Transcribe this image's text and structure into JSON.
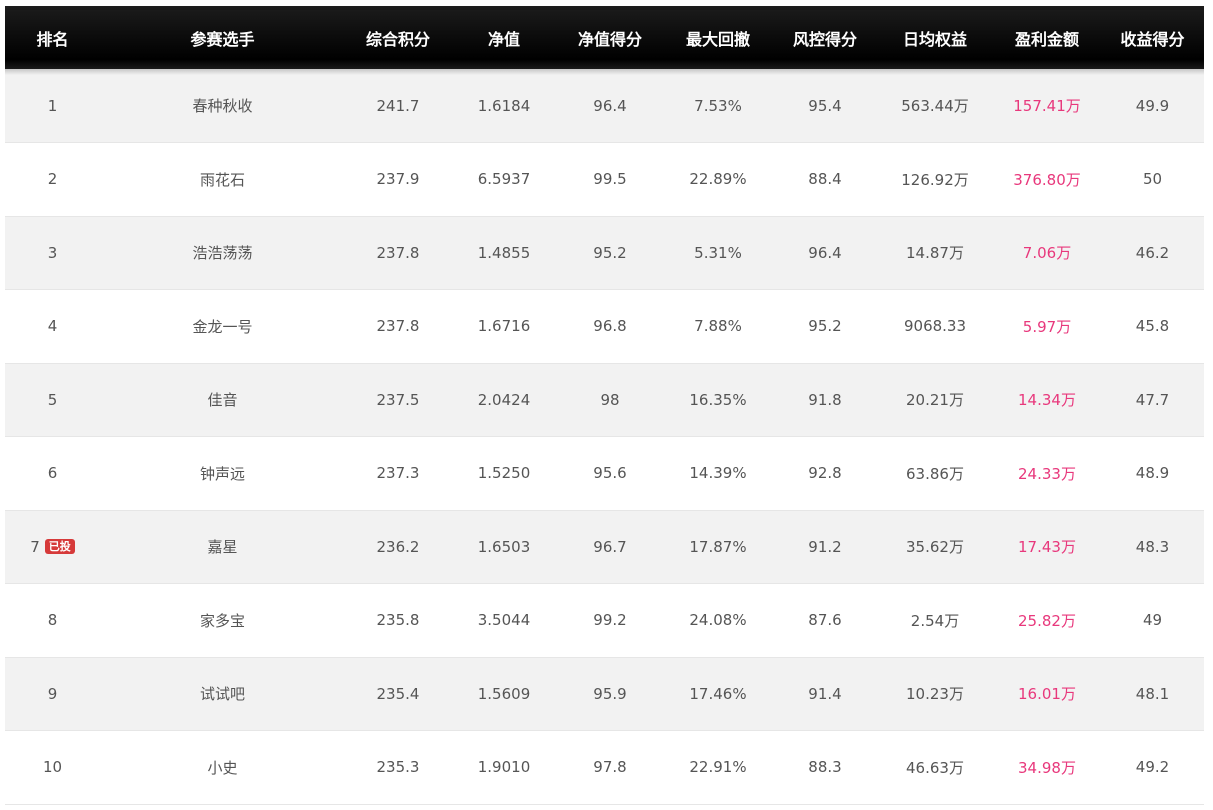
{
  "headers": {
    "rank": "排名",
    "name": "参赛选手",
    "composite": "综合积分",
    "nav": "净值",
    "nav_score": "净值得分",
    "max_drawdown": "最大回撤",
    "risk_score": "风控得分",
    "daily_equity": "日均权益",
    "profit": "盈利金额",
    "return_score": "收益得分"
  },
  "colors": {
    "header_bg": "#111111",
    "profit_text": "#e8387c",
    "badge_bg": "#d63a3a",
    "row_alt": "#f2f2f2"
  },
  "rows": [
    {
      "rank": "1",
      "name": "春种秋收",
      "composite": "241.7",
      "nav": "1.6184",
      "nav_score": "96.4",
      "max_drawdown": "7.53%",
      "risk_score": "95.4",
      "daily_equity": "563.44万",
      "profit": "157.41万",
      "return_score": "49.9",
      "badge": ""
    },
    {
      "rank": "2",
      "name": "雨花石",
      "composite": "237.9",
      "nav": "6.5937",
      "nav_score": "99.5",
      "max_drawdown": "22.89%",
      "risk_score": "88.4",
      "daily_equity": "126.92万",
      "profit": "376.80万",
      "return_score": "50",
      "badge": ""
    },
    {
      "rank": "3",
      "name": "浩浩荡荡",
      "composite": "237.8",
      "nav": "1.4855",
      "nav_score": "95.2",
      "max_drawdown": "5.31%",
      "risk_score": "96.4",
      "daily_equity": "14.87万",
      "profit": "7.06万",
      "return_score": "46.2",
      "badge": ""
    },
    {
      "rank": "4",
      "name": "金龙一号",
      "composite": "237.8",
      "nav": "1.6716",
      "nav_score": "96.8",
      "max_drawdown": "7.88%",
      "risk_score": "95.2",
      "daily_equity": "9068.33",
      "profit": "5.97万",
      "return_score": "45.8",
      "badge": ""
    },
    {
      "rank": "5",
      "name": "佳音",
      "composite": "237.5",
      "nav": "2.0424",
      "nav_score": "98",
      "max_drawdown": "16.35%",
      "risk_score": "91.8",
      "daily_equity": "20.21万",
      "profit": "14.34万",
      "return_score": "47.7",
      "badge": ""
    },
    {
      "rank": "6",
      "name": "钟声远",
      "composite": "237.3",
      "nav": "1.5250",
      "nav_score": "95.6",
      "max_drawdown": "14.39%",
      "risk_score": "92.8",
      "daily_equity": "63.86万",
      "profit": "24.33万",
      "return_score": "48.9",
      "badge": ""
    },
    {
      "rank": "7",
      "name": "嘉星",
      "composite": "236.2",
      "nav": "1.6503",
      "nav_score": "96.7",
      "max_drawdown": "17.87%",
      "risk_score": "91.2",
      "daily_equity": "35.62万",
      "profit": "17.43万",
      "return_score": "48.3",
      "badge": "已投"
    },
    {
      "rank": "8",
      "name": "家多宝",
      "composite": "235.8",
      "nav": "3.5044",
      "nav_score": "99.2",
      "max_drawdown": "24.08%",
      "risk_score": "87.6",
      "daily_equity": "2.54万",
      "profit": "25.82万",
      "return_score": "49",
      "badge": ""
    },
    {
      "rank": "9",
      "name": "试试吧",
      "composite": "235.4",
      "nav": "1.5609",
      "nav_score": "95.9",
      "max_drawdown": "17.46%",
      "risk_score": "91.4",
      "daily_equity": "10.23万",
      "profit": "16.01万",
      "return_score": "48.1",
      "badge": ""
    },
    {
      "rank": "10",
      "name": "小史",
      "composite": "235.3",
      "nav": "1.9010",
      "nav_score": "97.8",
      "max_drawdown": "22.91%",
      "risk_score": "88.3",
      "daily_equity": "46.63万",
      "profit": "34.98万",
      "return_score": "49.2",
      "badge": ""
    }
  ]
}
